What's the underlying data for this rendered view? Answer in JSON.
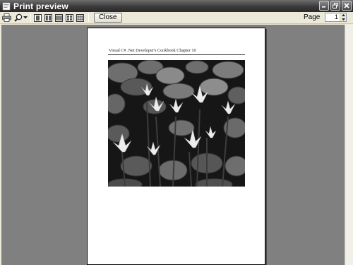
{
  "window": {
    "title": "Print preview"
  },
  "toolbar": {
    "close_label": "Close",
    "page_label": "Page",
    "page_value": "1"
  },
  "document": {
    "header": "Visual C# .Net Developer's Cookbook Chapter 10"
  },
  "icons": {
    "print": "printer-icon",
    "zoom": "magnifier-icon",
    "zoom_dropdown": "chevron-down-icon",
    "layouts": [
      "one-page-icon",
      "two-pages-icon",
      "three-pages-icon",
      "four-pages-icon",
      "six-pages-icon"
    ]
  },
  "colors": {
    "titlebar": "#3a3a3a",
    "toolbar": "#ece9d8",
    "preview_bg": "#808080",
    "paper": "#ffffff"
  }
}
